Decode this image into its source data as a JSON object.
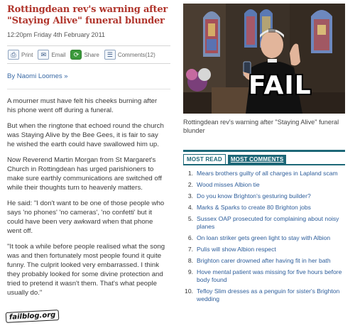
{
  "article": {
    "headline": "Rottingdean rev's warning after \"Staying Alive\" funeral blunder",
    "dateline": "12:20pm Friday 4th February 2011",
    "toolbar": {
      "print_label": "Print",
      "email_label": "Email",
      "share_label": "Share",
      "comments_label": "Comments(12)"
    },
    "byline": "By Naomi Loomes »",
    "paragraphs": [
      "A mourner must have felt his cheeks burning after his phone went off during a funeral.",
      "But when the ringtone that echoed round the church was Staying Alive by the Bee Gees, it is fair to say he wished the earth could have swallowed him up.",
      "Now Reverend Martin Morgan from St Margaret's Church in Rottingdean has urged parishioners to make sure earthly communications are switched off while their thoughts turn to heavenly matters.",
      "He said: \"I don't want to be one of those people who says 'no phones' 'no cameras', 'no confetti' but it could have been very awkward when that phone went off.",
      "\"It took a while before people realised what the song was and then fortunately most people found it quite funny. The culprit looked very embarrassed. I think they probably looked for some divine protection and tried to pretend it wasn't them. That's what people usually do.\""
    ]
  },
  "watermark": "failblog.org",
  "photo": {
    "overlay_text": "FAIL",
    "caption": "Rottingdean rev's warning after \"Staying Alive\" funeral blunder"
  },
  "most_read": {
    "tabs": [
      "MOST READ",
      "MOST COMMENTS"
    ],
    "items": [
      "Mears brothers guilty of all charges in Lapland scam",
      "Wood misses Albion tie",
      "Do you know Brighton's gesturing builder?",
      "Marks & Sparks to create 80 Brighton jobs",
      "Sussex OAP prosecuted for complaining about noisy planes",
      "On loan striker gets green light to stay with Albion",
      "Pulis will show Albion respect",
      "Brighton carer drowned after having fit in her bath",
      "Hove mental patient was missing for five hours before body found",
      "Tefloy Slim dresses as a penguin for sister's Brighton wedding"
    ]
  },
  "colors": {
    "headline": "#b0342b",
    "link": "#2d5d9a",
    "tab_accent": "#1e6878"
  },
  "icons": {
    "print": "printer-icon",
    "email": "envelope-icon",
    "share": "share-icon",
    "comments": "speech-bubble-icon"
  }
}
